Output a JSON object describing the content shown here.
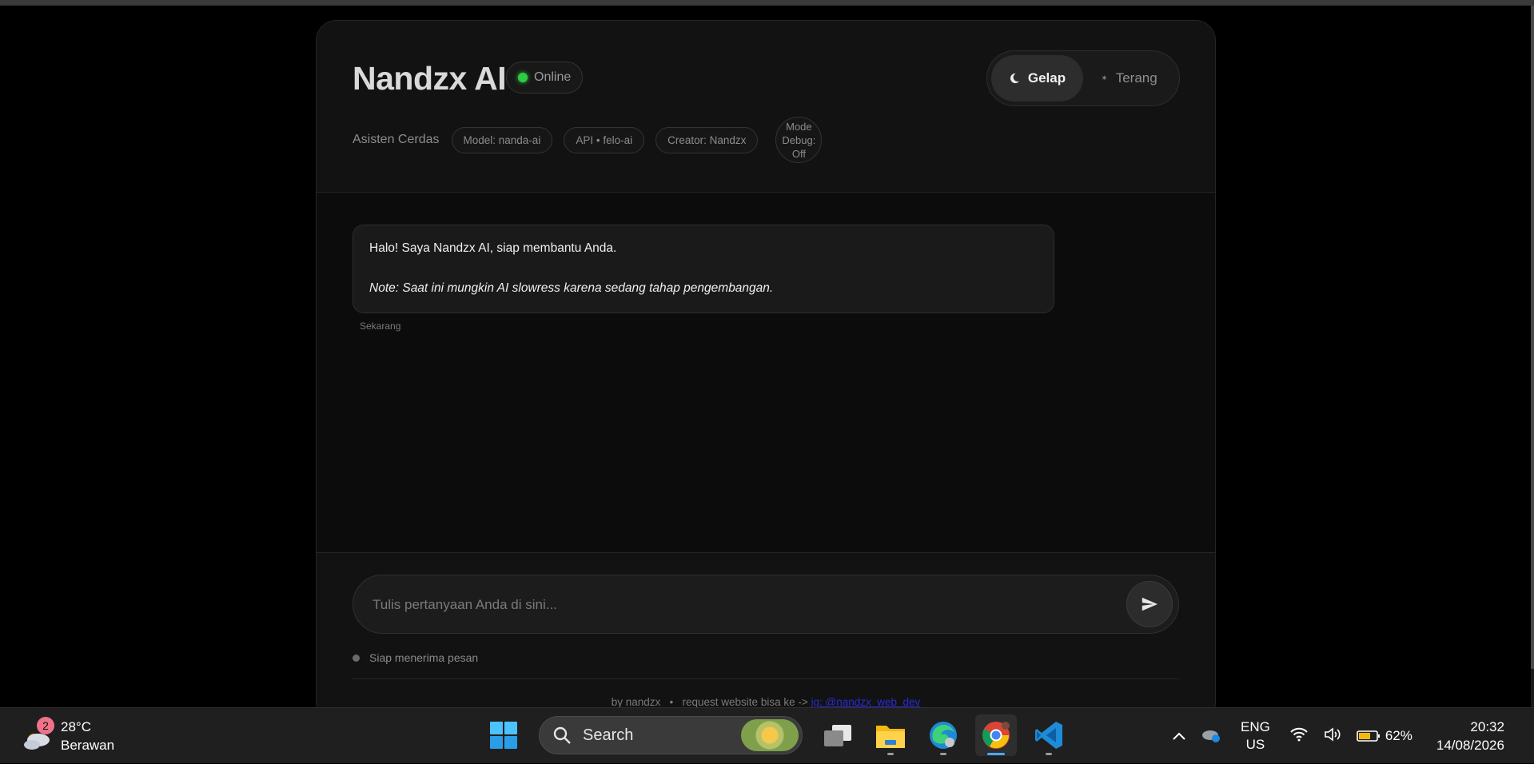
{
  "app": {
    "title": "Nandzx AI",
    "status": "Online",
    "subtitle": "Asisten Cerdas",
    "chips": [
      "Model: nanda-ai",
      "API • felo-ai",
      "Creator: Nandzx"
    ],
    "debug": {
      "line1": "Mode",
      "line2": "Debug:",
      "line3": "Off"
    },
    "theme": {
      "dark_label": "Gelap",
      "light_label": "Terang",
      "active": "Gelap"
    }
  },
  "messages": [
    {
      "line1": "Halo! Saya Nandzx AI, siap membantu Anda.",
      "line2": "Note: Saat ini mungkin AI slowress karena sedang tahap pengembangan.",
      "time": "Sekarang"
    }
  ],
  "composer": {
    "placeholder": "Tulis pertanyaan Anda di sini...",
    "value": "",
    "status": "Siap menerima pesan"
  },
  "footer": {
    "by": "by nandzx",
    "sep": "•",
    "request": "request website bisa ke ->",
    "link": "ig: @nandzx_web_dev"
  },
  "taskbar": {
    "weather_temp": "28°C",
    "weather_desc": "Berawan",
    "weather_badge": "2",
    "search_label": "Search",
    "apps": [
      "task-view-icon",
      "file-explorer-icon",
      "edge-icon",
      "chrome-icon",
      "vscode-icon"
    ],
    "lang_top": "ENG",
    "lang_bottom": "US",
    "battery": "62%",
    "time": "20:32",
    "date": "14/08/2026"
  },
  "colors": {
    "online": "#2ecc40",
    "link": "#2b2bd6",
    "accent_indicator": "#4ca6ff"
  }
}
